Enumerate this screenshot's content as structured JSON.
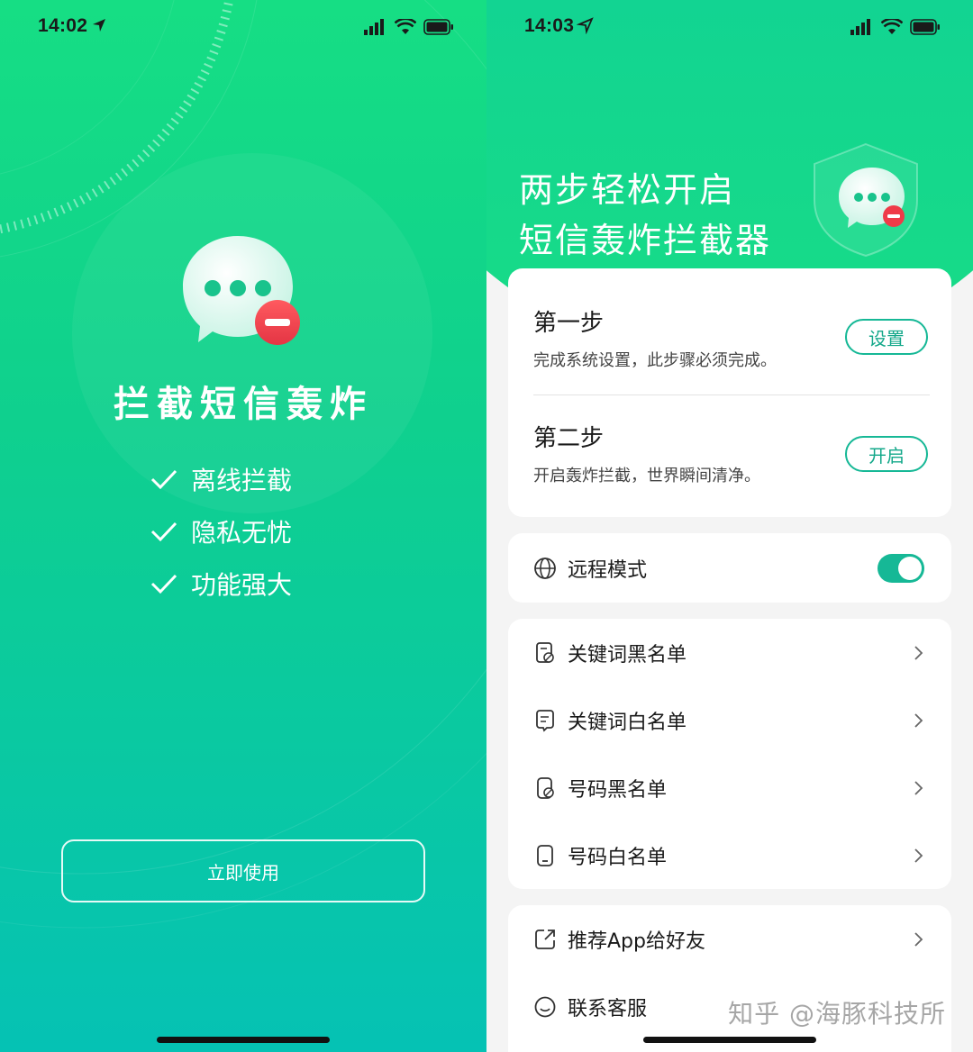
{
  "left": {
    "status": {
      "time": "14:02"
    },
    "title": "拦截短信轰炸",
    "features": [
      "离线拦截",
      "隐私无忧",
      "功能强大"
    ],
    "start_button": "立即使用"
  },
  "right": {
    "status": {
      "time": "14:03"
    },
    "hero": {
      "line1": "两步轻松开启",
      "line2": "短信轰炸拦截器"
    },
    "steps": [
      {
        "title": "第一步",
        "desc": "完成系统设置，此步骤必须完成。",
        "button": "设置"
      },
      {
        "title": "第二步",
        "desc": "开启轰炸拦截，世界瞬间清净。",
        "button": "开启"
      }
    ],
    "remote_mode": {
      "label": "远程模式",
      "enabled": true
    },
    "lists": [
      {
        "label": "关键词黑名单",
        "icon": "keyword-blacklist-icon"
      },
      {
        "label": "关键词白名单",
        "icon": "keyword-whitelist-icon"
      },
      {
        "label": "号码黑名单",
        "icon": "number-blacklist-icon"
      },
      {
        "label": "号码白名单",
        "icon": "number-whitelist-icon"
      }
    ],
    "more": [
      {
        "label": "推荐App给好友",
        "icon": "share-icon"
      },
      {
        "label": "联系客服",
        "icon": "customer-service-icon"
      }
    ],
    "watermark": "知乎 @海豚科技所"
  },
  "colors": {
    "accent": "#16b896",
    "gradient_top": "#16de84",
    "gradient_bottom": "#05c2b4",
    "badge_red": "#ef3b48"
  }
}
